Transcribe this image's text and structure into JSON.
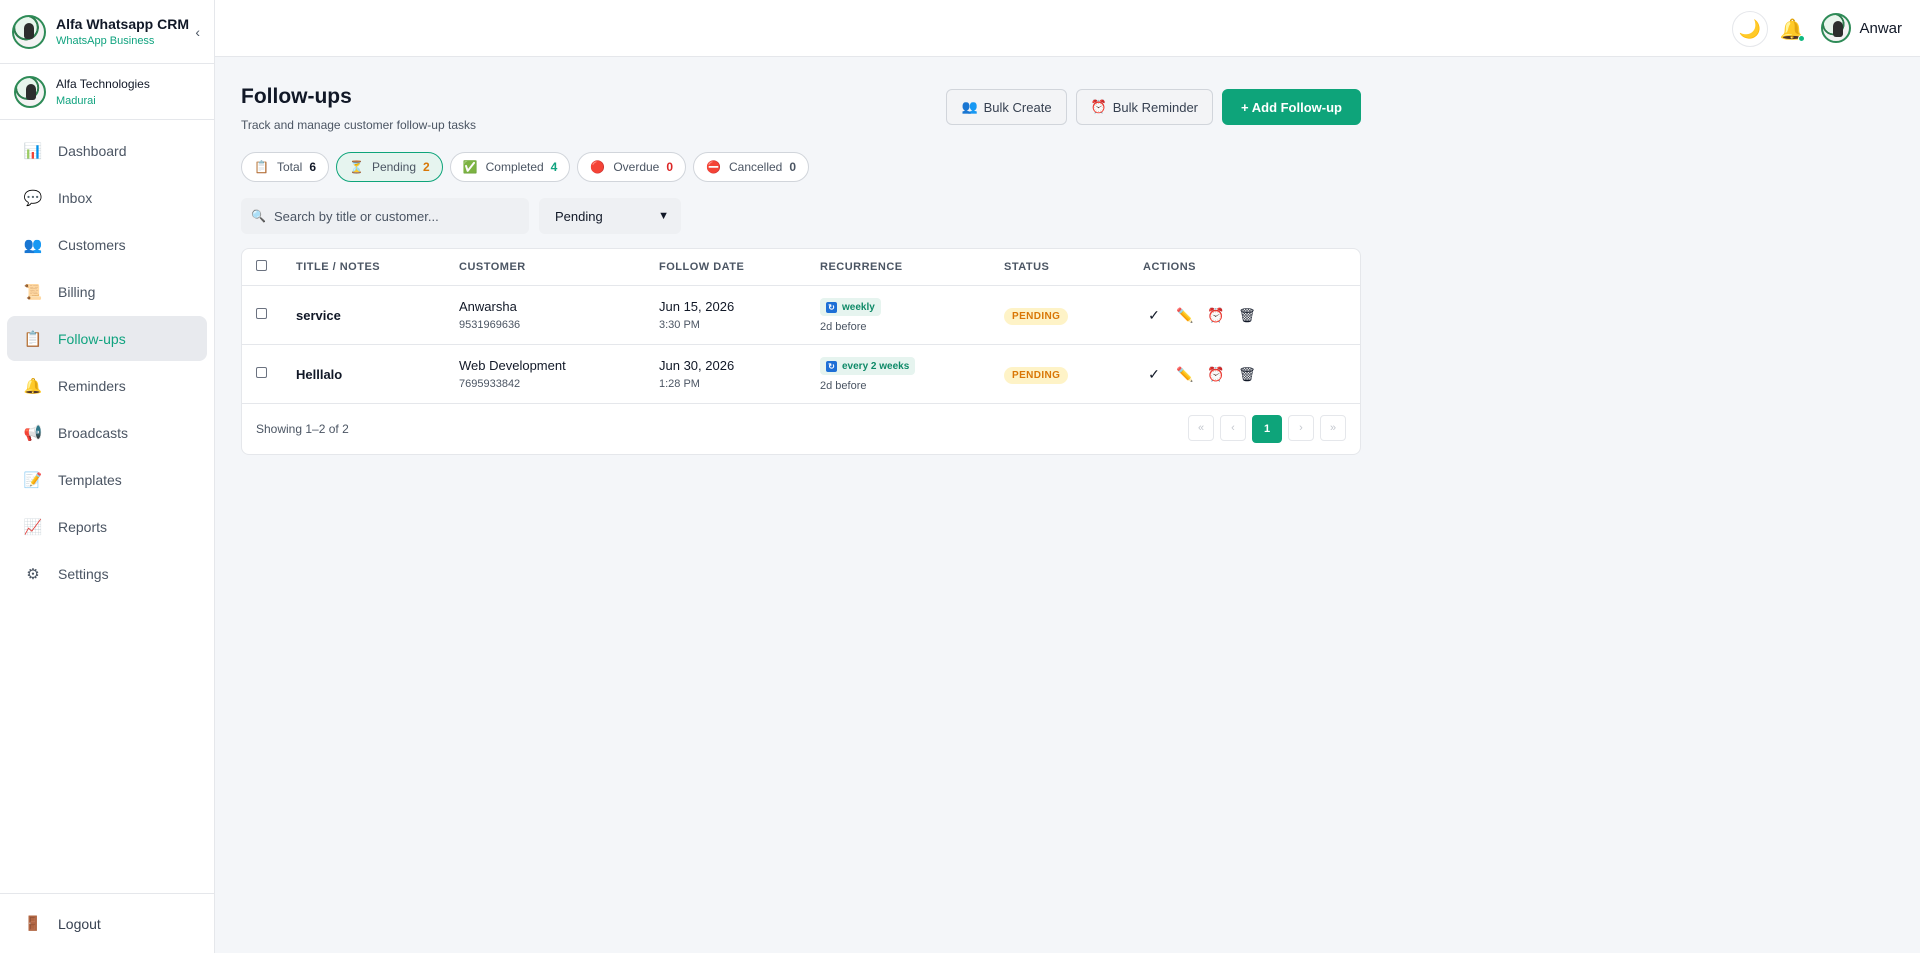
{
  "brand": {
    "title": "Alfa Whatsapp CRM",
    "subtitle": "WhatsApp Business",
    "collapse_icon": "‹"
  },
  "company": {
    "name": "Alfa Technologies",
    "location": "Madurai"
  },
  "sidebar": {
    "items": [
      {
        "label": "Dashboard",
        "icon": "chart-icon",
        "glyph": "📊"
      },
      {
        "label": "Inbox",
        "icon": "chat-icon",
        "glyph": "💬"
      },
      {
        "label": "Customers",
        "icon": "users-icon",
        "glyph": "👥"
      },
      {
        "label": "Billing",
        "icon": "scroll-icon",
        "glyph": "📜"
      },
      {
        "label": "Follow-ups",
        "icon": "clipboard-icon",
        "glyph": "📋",
        "active": true
      },
      {
        "label": "Reminders",
        "icon": "bell-icon",
        "glyph": "🔔"
      },
      {
        "label": "Broadcasts",
        "icon": "megaphone-icon",
        "glyph": "📢"
      },
      {
        "label": "Templates",
        "icon": "memo-icon",
        "glyph": "📝"
      },
      {
        "label": "Reports",
        "icon": "trend-icon",
        "glyph": "📈"
      },
      {
        "label": "Settings",
        "icon": "gear-icon",
        "glyph": "⚙"
      }
    ],
    "logout": {
      "label": "Logout",
      "glyph": "🚪"
    }
  },
  "topbar": {
    "theme_glyph": "🌙",
    "bell_glyph": "🔔",
    "user_name": "Anwar"
  },
  "page": {
    "title": "Follow-ups",
    "subtitle": "Track and manage customer follow-up tasks"
  },
  "actions": {
    "bulk_create": "Bulk Create",
    "bulk_create_glyph": "👥",
    "bulk_reminder": "Bulk Reminder",
    "bulk_reminder_glyph": "⏰",
    "add": "+ Add Follow-up"
  },
  "chips": [
    {
      "label": "Total",
      "count": "6",
      "glyph": "📋",
      "color": "dark"
    },
    {
      "label": "Pending",
      "count": "2",
      "glyph": "⏳",
      "color": "amber",
      "active": true
    },
    {
      "label": "Completed",
      "count": "4",
      "glyph": "✅",
      "color": "green"
    },
    {
      "label": "Overdue",
      "count": "0",
      "glyph": "🔴",
      "color": "red"
    },
    {
      "label": "Cancelled",
      "count": "0",
      "glyph": "⛔",
      "color": "gray"
    }
  ],
  "search": {
    "placeholder": "Search by title or customer...",
    "glyph": "🔍"
  },
  "status_filter": {
    "selected": "Pending"
  },
  "table": {
    "columns": [
      "TITLE / NOTES",
      "CUSTOMER",
      "FOLLOW DATE",
      "RECURRENCE",
      "STATUS",
      "ACTIONS"
    ],
    "rows": [
      {
        "title": "service",
        "customer": "Anwarsha",
        "phone": "9531969636",
        "date": "Jun 15, 2026",
        "time": "3:30 PM",
        "recurrence": "weekly",
        "before": "2d before",
        "status": "PENDING"
      },
      {
        "title": "Helllalo",
        "customer": "Web Development",
        "phone": "7695933842",
        "date": "Jun 30, 2026",
        "time": "1:28 PM",
        "recurrence": "every 2 weeks",
        "before": "2d before",
        "status": "PENDING"
      }
    ],
    "action_glyphs": {
      "complete": "✓",
      "edit": "✏️",
      "remind": "⏰",
      "delete": "🗑"
    },
    "showing": "Showing 1–2 of 2",
    "pager": {
      "first": "«",
      "prev": "‹",
      "current": "1",
      "next": "›",
      "last": "»"
    }
  },
  "colors": {
    "accent": "#0ea47a",
    "pending": "#d97706"
  }
}
